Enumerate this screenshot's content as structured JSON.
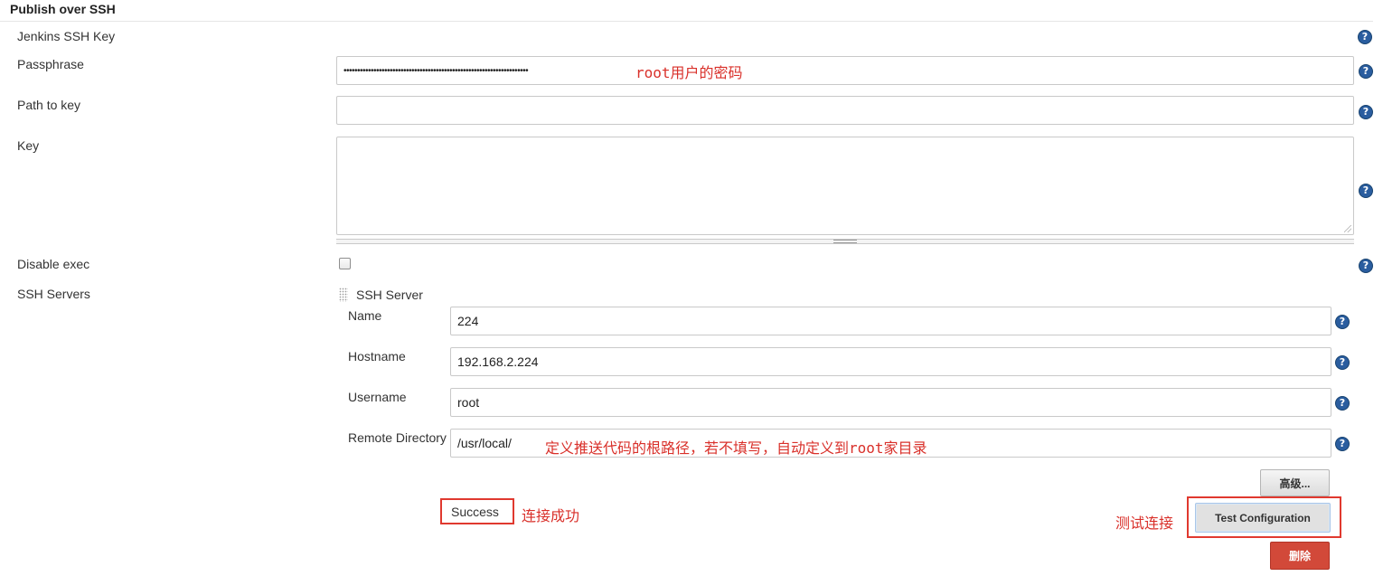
{
  "section": {
    "title": "Publish over SSH"
  },
  "fields": {
    "jenkins_ssh_key": {
      "label": "Jenkins SSH Key"
    },
    "passphrase": {
      "label": "Passphrase",
      "value": "••••••••••••••••••••••••••••••••••••••••••••••••••••••••••••••••••••",
      "annotation": "root用户的密码"
    },
    "path_to_key": {
      "label": "Path to key",
      "value": ""
    },
    "key": {
      "label": "Key",
      "value": ""
    },
    "disable_exec": {
      "label": "Disable exec",
      "checked": false
    },
    "ssh_servers": {
      "label": "SSH Servers"
    }
  },
  "ssh_server": {
    "header": "SSH Server",
    "name": {
      "label": "Name",
      "value": "224"
    },
    "hostname": {
      "label": "Hostname",
      "value": "192.168.2.224"
    },
    "username": {
      "label": "Username",
      "value": "root"
    },
    "remote_directory": {
      "label": "Remote Directory",
      "value": "/usr/local/",
      "annotation": "定义推送代码的根路径，若不填写，自动定义到root家目录"
    },
    "advanced_button": "高级...",
    "test_button": "Test Configuration",
    "delete_button": "删除"
  },
  "result": {
    "status": "Success",
    "status_annotation": "连接成功",
    "test_annotation": "测试连接"
  },
  "icons": {
    "help": "question-mark-icon",
    "drag": "drag-handle-icon"
  },
  "colors": {
    "annotation": "#d9302a",
    "help_icon": "#2a5d9f",
    "delete_button": "#d24939"
  }
}
